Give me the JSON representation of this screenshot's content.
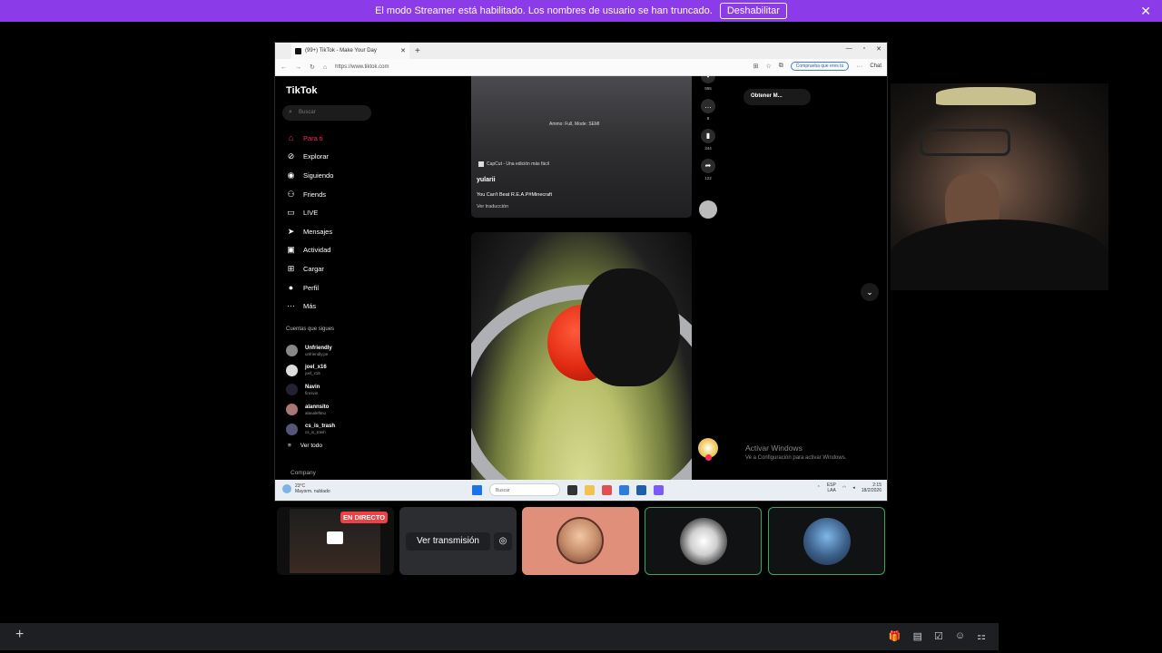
{
  "banner": {
    "text": "El modo Streamer está habilitado. Los nombres de usuario se han truncado.",
    "button": "Deshabilitar",
    "close": "✕"
  },
  "browser": {
    "tab_title": "(99+) TikTok - Make Your Day",
    "url": "https://www.tiktok.com",
    "check_pill": "Comprueba que eres tú",
    "chat": "Chat",
    "controls": {
      "min": "—",
      "max": "▫",
      "close": "✕"
    }
  },
  "tiktok": {
    "logo": "TikTok",
    "search_placeholder": "Buscar",
    "nav": [
      {
        "label": "Para ti",
        "icon": "home-icon",
        "glyph": "⌂"
      },
      {
        "label": "Explorar",
        "icon": "compass-icon",
        "glyph": "⊘"
      },
      {
        "label": "Siguiendo",
        "icon": "following-icon",
        "glyph": "◉"
      },
      {
        "label": "Friends",
        "icon": "friends-icon",
        "glyph": "⚇"
      },
      {
        "label": "LIVE",
        "icon": "live-icon",
        "glyph": "▭"
      },
      {
        "label": "Mensajes",
        "icon": "send-icon",
        "glyph": "➤"
      },
      {
        "label": "Actividad",
        "icon": "inbox-icon",
        "glyph": "▣"
      },
      {
        "label": "Cargar",
        "icon": "upload-icon",
        "glyph": "⊞"
      },
      {
        "label": "Perfil",
        "icon": "profile-icon",
        "glyph": "●"
      },
      {
        "label": "Más",
        "icon": "more-icon",
        "glyph": "···"
      }
    ],
    "follows_heading": "Cuentas que sigues",
    "follows": [
      {
        "name": "Unfriendly",
        "user": "unfriendly.pe"
      },
      {
        "name": "joel_x16",
        "user": "joel_x16"
      },
      {
        "name": "Navin",
        "user": "firesvin"
      },
      {
        "name": "alannsito",
        "user": "alanaleftinu"
      },
      {
        "name": "cs_is_trash",
        "user": "cs_is_trash"
      }
    ],
    "see_all": "Ver todo",
    "company": "Company",
    "video1": {
      "mode_text": "Ammo: Full, Mode: SEMI",
      "badge": "CapCut - Una edición más fácil",
      "user": "yularii",
      "caption": "You Can't Beat R.E.A.P#Minecraft",
      "translate": "Ver traducción"
    },
    "actions": [
      {
        "icon": "heart-icon",
        "glyph": "♥",
        "count": "955"
      },
      {
        "icon": "comment-icon",
        "glyph": "…",
        "count": "8"
      },
      {
        "icon": "bookmark-icon",
        "glyph": "▮",
        "count": "344"
      },
      {
        "icon": "share-icon",
        "glyph": "➦",
        "count": "122"
      }
    ],
    "get_app": "Obtener M...",
    "scroll_down": "⌄",
    "activate_title": "Activar Windows",
    "activate_sub": "Ve a Configuración para activar Windows."
  },
  "taskbar": {
    "temp": "23°C",
    "weather": "Mayorm. nublado",
    "search": "Buscar",
    "lang1": "ESP",
    "lang2": "LAA",
    "time": "2:15",
    "date": "18/2/2026"
  },
  "call": {
    "live_badge": "EN DIRECTO",
    "watch_stream": "Ver transmisión"
  },
  "bottom": {
    "add": "+",
    "icons": [
      "🎁",
      "▤",
      "☑",
      "☺",
      "⚏"
    ]
  }
}
